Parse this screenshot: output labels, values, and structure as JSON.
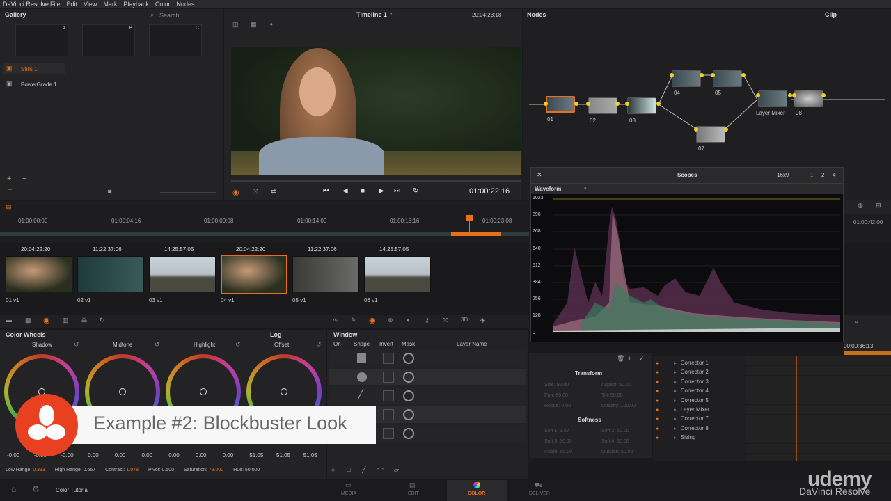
{
  "menubar": {
    "app": "DaVinci Resolve",
    "items": [
      "File",
      "Edit",
      "View",
      "Mark",
      "Playback",
      "Color",
      "Nodes"
    ]
  },
  "gallery": {
    "title": "Gallery",
    "search": "Search",
    "slots": [
      "A",
      "B",
      "C"
    ],
    "albums": [
      "Stills 1",
      "PowerGrade 1"
    ]
  },
  "viewer": {
    "timeline": "Timeline 1",
    "timecode_top": "20:04:23:18",
    "timecode_bottom": "01:00:22:16"
  },
  "nodes": {
    "title": "Nodes",
    "mode": "Clip",
    "labels": [
      "01",
      "02",
      "03",
      "04",
      "05",
      "07",
      "08"
    ],
    "mixer": "Layer Mixer"
  },
  "scopes": {
    "title": "Scopes",
    "layout": "16x9",
    "pages": [
      "1",
      "2",
      "4"
    ],
    "type": "Waveform",
    "scale": [
      "1023",
      "896",
      "768",
      "640",
      "512",
      "384",
      "256",
      "128",
      "0"
    ]
  },
  "timeline_ruler": [
    "01:00:00:00",
    "01:00:04:16",
    "01:00:09:08",
    "01:00:14:00",
    "01:00:18:16",
    "01:00:23:08",
    "01:00:42:00"
  ],
  "clips": [
    {
      "tc": "20:04:22:20",
      "label": "01  v1"
    },
    {
      "tc": "11:22:37:06",
      "label": "02  v1"
    },
    {
      "tc": "14:25:57:05",
      "label": "03  v1"
    },
    {
      "tc": "20:04:22:20",
      "label": "04  v1"
    },
    {
      "tc": "11:22:37:06",
      "label": "05  v1"
    },
    {
      "tc": "14:25:57:05",
      "label": "06  v1"
    }
  ],
  "color_wheels": {
    "title": "Color Wheels",
    "mode": "Log",
    "wheels": [
      "Shadow",
      "Midtone",
      "Highlight",
      "Offset"
    ],
    "values": [
      "-0.00",
      "-0.00",
      "-0.00",
      "0.00",
      "0.00",
      "0.00",
      "0.00",
      "0.00",
      "0.00",
      "51.05",
      "51.05",
      "51.05"
    ],
    "footer": {
      "low_range_label": "Low Range:",
      "low_range": "0.333",
      "high_range_label": "High Range:",
      "high_range": "0.667",
      "contrast_label": "Contrast:",
      "contrast": "1.078",
      "pivot_label": "Pivot:",
      "pivot": "0.500",
      "saturation_label": "Saturation:",
      "saturation": "79.000",
      "hue_label": "Hue:",
      "hue": "50.000"
    }
  },
  "window": {
    "title": "Window",
    "columns": [
      "On",
      "Shape",
      "Invert",
      "Mask",
      "Layer Name"
    ]
  },
  "transform": {
    "title": "Transform",
    "softness": "Softness",
    "fields": [
      "Size: 50.00",
      "Aspect: 50.00",
      "Pan: 50.00",
      "Tilt: 50.00",
      "Rotate: 0.00",
      "Opacity: 100.00"
    ],
    "soft_fields": [
      "Soft 1: 1.57",
      "Soft 2: 50.00",
      "Soft 3: 50.00",
      "Soft 4: 50.00",
      "Inside: 50.00",
      "Outside: 50.00"
    ]
  },
  "keyframes": {
    "timecode": "00:00:36:13",
    "tracks": [
      "Corrector 1",
      "Corrector 2",
      "Corrector 3",
      "Corrector 4",
      "Corrector 5",
      "Layer Mixer",
      "Corrector 7",
      "Corrector 8",
      "Sizing"
    ]
  },
  "overlay": {
    "title": "Example #2: Blockbuster Look"
  },
  "bottombar": {
    "project": "Color Tutorial",
    "pages": [
      "MEDIA",
      "EDIT",
      "COLOR",
      "DELIVER"
    ],
    "brand": "udemy",
    "watermark": "DaVinci Resolve"
  },
  "colors": {
    "accent": "#e8701a",
    "bg": "#1a1a1c",
    "panel": "#232325"
  }
}
